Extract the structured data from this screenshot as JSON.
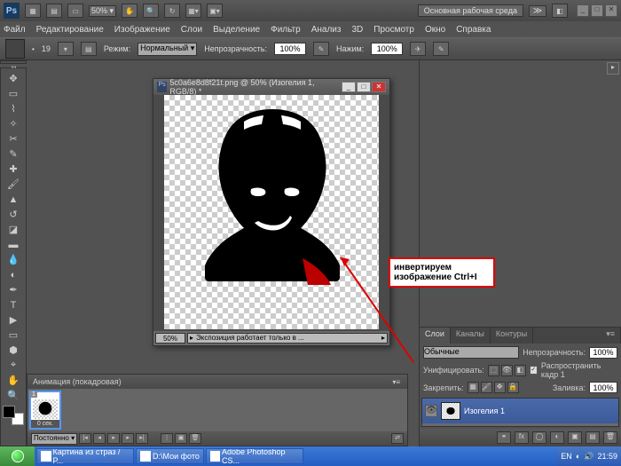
{
  "app": {
    "logo": "Ps",
    "zoom_preset": "50%",
    "workspace": "Основная рабочая среда"
  },
  "menu": [
    "Файл",
    "Редактирование",
    "Изображение",
    "Слои",
    "Выделение",
    "Фильтр",
    "Анализ",
    "3D",
    "Просмотр",
    "Окно",
    "Справка"
  ],
  "options": {
    "brush_size": "19",
    "mode_label": "Режим:",
    "mode": "Нормальный",
    "opacity_label": "Непрозрачность:",
    "opacity": "100%",
    "flow_label": "Нажим:",
    "flow": "100%"
  },
  "document": {
    "title": "5c0a6e8d8f21t.png @ 50% (Изогелия 1, RGB/8) *",
    "status_zoom": "50%",
    "status_info": "Экспозиция работает только в ..."
  },
  "callout": {
    "line1": "инвертируем",
    "line2": "изображение Ctrl+I"
  },
  "layers": {
    "tabs": [
      "Слои",
      "Каналы",
      "Контуры"
    ],
    "blend_mode": "Обычные",
    "opacity_label": "Непрозрачность:",
    "opacity": "100%",
    "unify_label": "Унифицировать:",
    "propagate": "Распространить кадр 1",
    "lock_label": "Закрепить:",
    "fill_label": "Заливка:",
    "fill": "100%",
    "layer_name": "Изогелия 1"
  },
  "animation": {
    "title": "Анимация (покадровая)",
    "frame_num": "1",
    "frame_time": "0 сек.",
    "loop": "Постоянно"
  },
  "taskbar": {
    "items": [
      "Картина из страз / Р...",
      "D:\\Мои фото",
      "Adobe Photoshop CS..."
    ],
    "lang": "EN",
    "time": "21:59"
  }
}
